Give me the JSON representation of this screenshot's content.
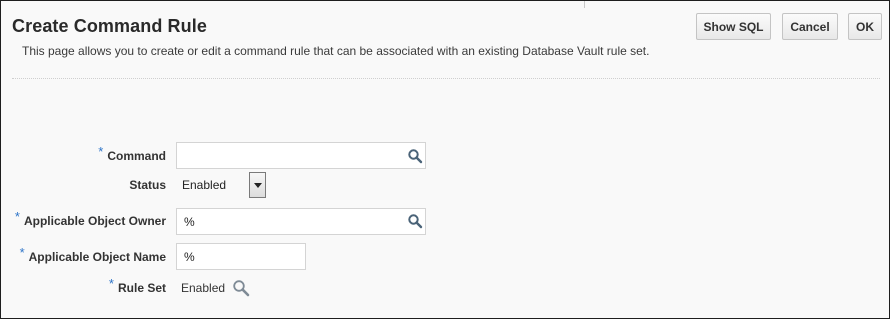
{
  "header": {
    "title": "Create Command Rule",
    "description": "This page allows you to create or edit a command rule that can be associated with an existing Database Vault rule set."
  },
  "toolbar": {
    "show_sql_label": "Show SQL",
    "cancel_label": "Cancel",
    "ok_label": "OK"
  },
  "form": {
    "required_marker": "*",
    "command": {
      "label": "Command",
      "value": "",
      "required": true,
      "icon": "search-icon"
    },
    "status": {
      "label": "Status",
      "selected": "Enabled",
      "icon": "chevron-down-icon"
    },
    "object_owner": {
      "label": "Applicable Object Owner",
      "value": "%",
      "required": true,
      "icon": "search-icon"
    },
    "object_name": {
      "label": "Applicable Object Name",
      "value": "%",
      "required": true
    },
    "rule_set": {
      "label": "Rule Set",
      "value": "Enabled",
      "required": true,
      "icon": "search-icon"
    }
  },
  "colors": {
    "required_marker": "#2d74c8",
    "background": "#f9f9f9"
  }
}
